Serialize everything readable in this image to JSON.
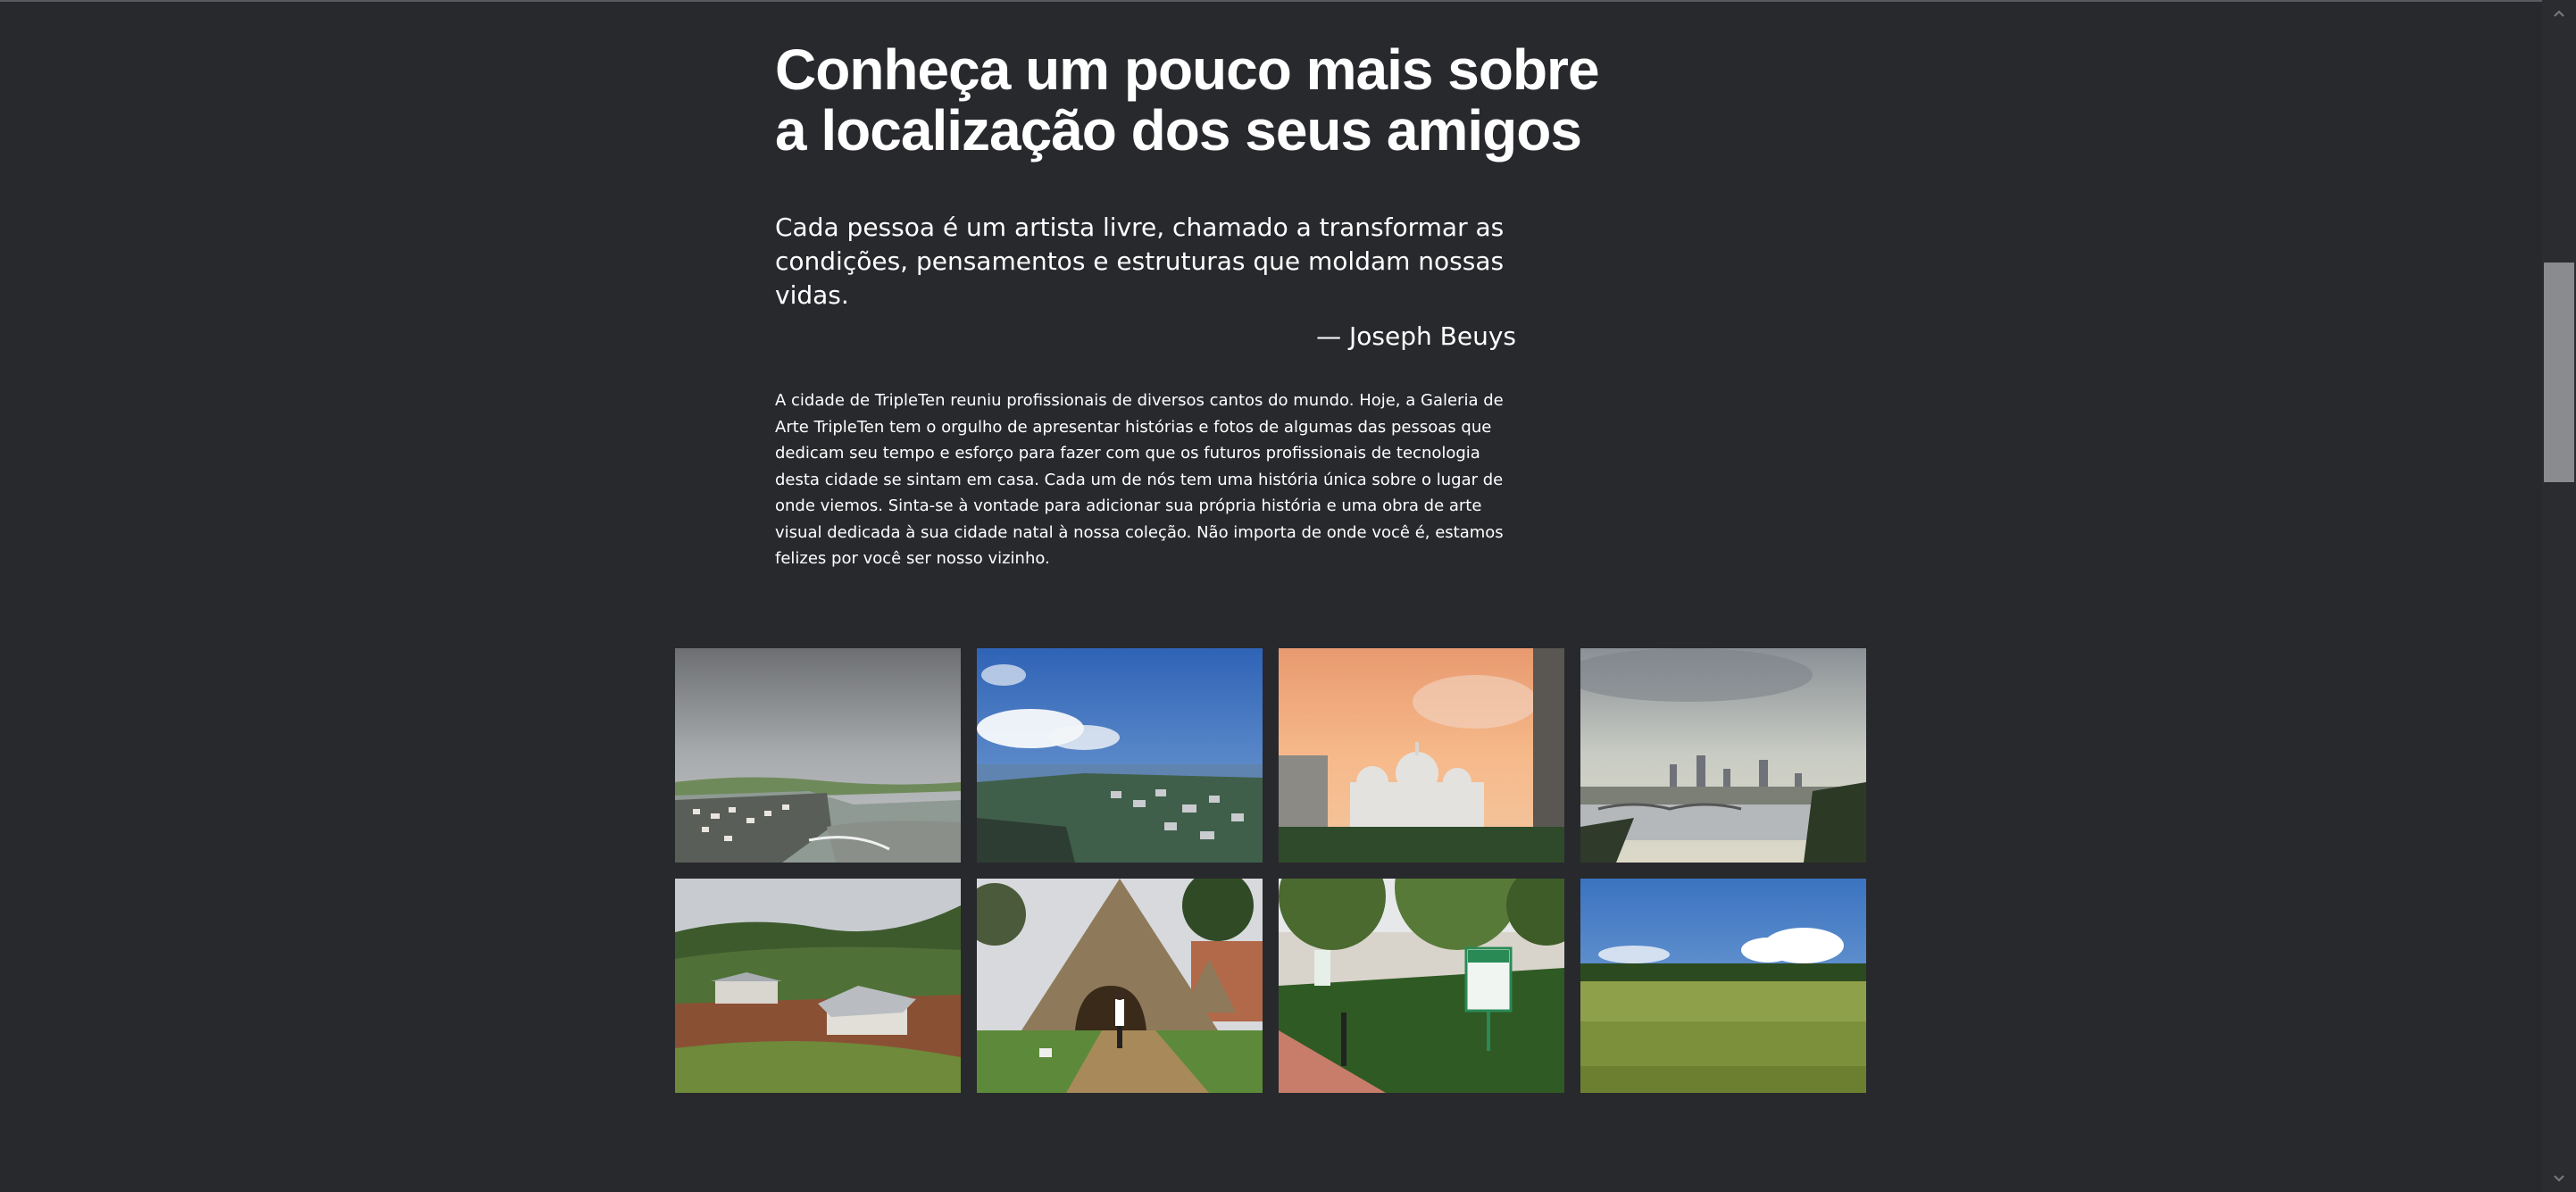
{
  "header": {
    "title_line1": "Conheça um pouco mais sobre",
    "title_line2": "a localização dos seus amigos"
  },
  "quote": {
    "text": "Cada pessoa é um artista livre, chamado a transformar as condições, pensamentos e estruturas que moldam nossas vidas.",
    "author": "— Joseph Beuys"
  },
  "intro": {
    "text": "A cidade de TripleTen reuniu profissionais de diversos cantos do mundo. Hoje, a Galeria de Arte TripleTen tem o orgulho de apresentar histórias e fotos de algumas das pessoas que dedicam seu tempo e esforço para fazer com que os futuros profissionais de tecnologia desta cidade se sintam em casa. Cada um de nós tem uma história única sobre o lugar de onde viemos. Sinta-se à vontade para adicionar sua própria história e uma obra de arte visual dedicada à sua cidade natal à nossa coleção. Não importa de onde você é, estamos felizes por você ser nosso vizinho."
  },
  "scrollbar": {
    "position_fraction": 0.22
  }
}
